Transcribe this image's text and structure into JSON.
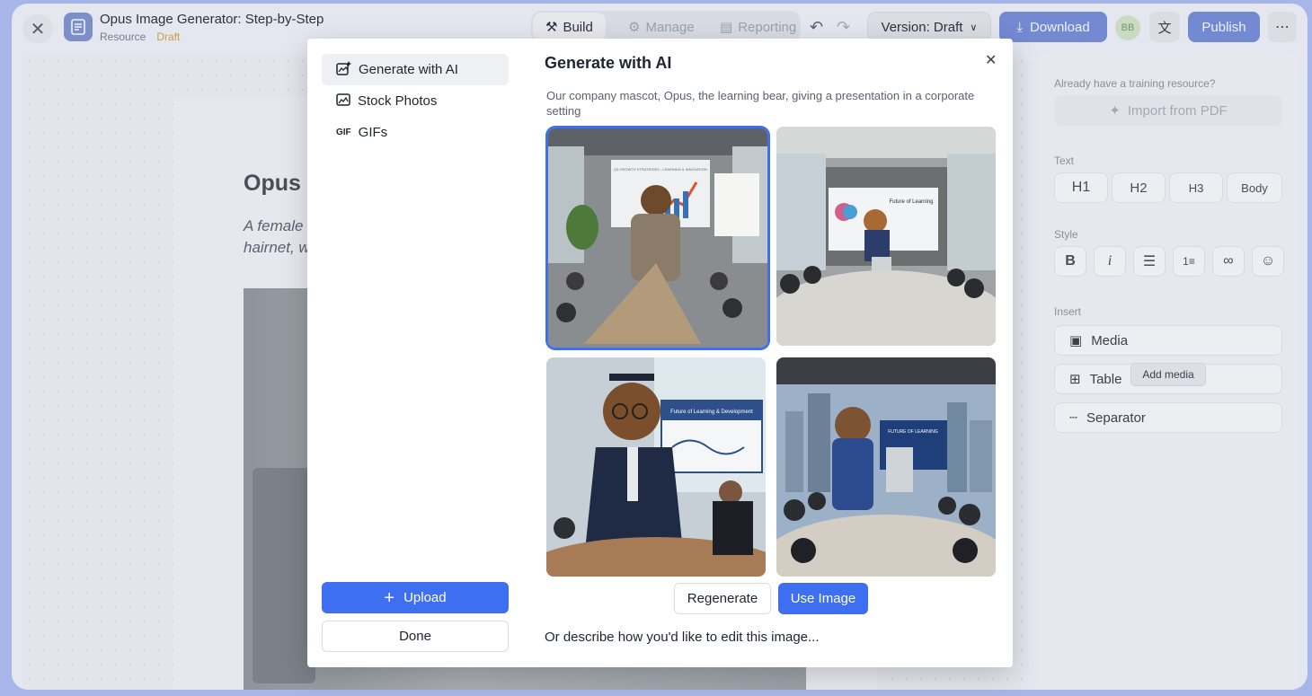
{
  "app": {
    "title": "Opus Image Generator: Step-by-Step",
    "type": "Resource",
    "status": "Draft",
    "tabs": [
      {
        "label": "Build",
        "icon": "wrench-icon",
        "active": true
      },
      {
        "label": "Manage",
        "icon": "gear-icon",
        "active": false
      },
      {
        "label": "Reporting",
        "icon": "clipboard-icon",
        "active": false
      }
    ],
    "version_label": "Version: Draft",
    "download_label": "Download",
    "avatar_initials": "BB",
    "publish_label": "Publish"
  },
  "document": {
    "heading": "Opus I",
    "italic_line1": "A female",
    "italic_line2": "hairnet, w"
  },
  "right_panel": {
    "import_hint": "Already have a training resource?",
    "import_label": "Import from PDF",
    "text_section": "Text",
    "text_buttons": [
      "H1",
      "H2",
      "H3",
      "Body"
    ],
    "style_section": "Style",
    "style_buttons": [
      "bold-icon",
      "italic-icon",
      "bullet-list-icon",
      "numbered-list-icon",
      "link-icon",
      "emoji-icon"
    ],
    "insert_section": "Insert",
    "insert_buttons": [
      {
        "label": "Media",
        "icon": "image-icon"
      },
      {
        "label": "Table",
        "icon": "table-icon"
      },
      {
        "label": "Separator",
        "icon": "separator-icon"
      }
    ],
    "tooltip": "Add media"
  },
  "modal": {
    "menu": [
      {
        "label": "Generate with AI",
        "icon": "ai-image-icon",
        "active": true
      },
      {
        "label": "Stock Photos",
        "icon": "image-icon",
        "active": false
      },
      {
        "label": "GIFs",
        "icon": "gif-icon",
        "active": false
      }
    ],
    "upload_label": "Upload",
    "done_label": "Done",
    "title": "Generate with AI",
    "prompt": "Our company mascot, Opus, the learning bear, giving a presentation in a corporate setting",
    "images": [
      {
        "selected": true,
        "slide": "Q3 GROWTH STRATEGIES - LEARNING & INNOVATION"
      },
      {
        "selected": false,
        "slide": "Future of Learning"
      },
      {
        "selected": false,
        "slide": "Future of Learning & Development"
      },
      {
        "selected": false,
        "slide": "FUTURE OF LEARNING"
      }
    ],
    "regenerate_label": "Regenerate",
    "use_image_label": "Use Image",
    "edit_placeholder": "Or describe how you'd like to edit this image...",
    "accent_color": "#3e6ff0"
  }
}
